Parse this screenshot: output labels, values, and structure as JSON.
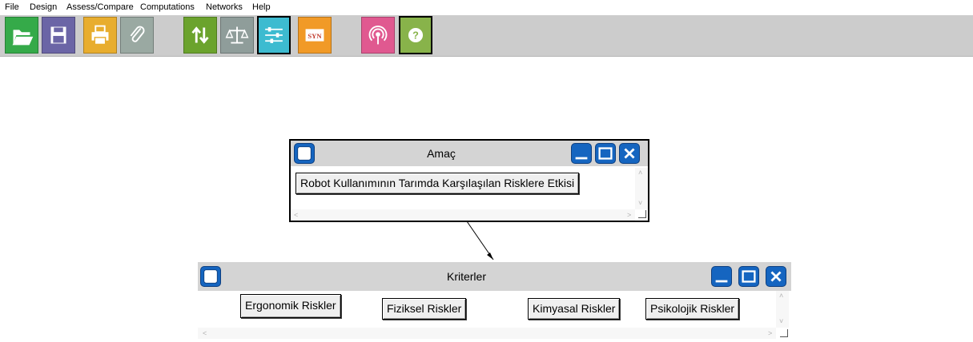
{
  "menu": {
    "items": [
      "File",
      "Design",
      "Assess/Compare",
      "Computations",
      "Networks",
      "Help"
    ]
  },
  "toolbar": {
    "buttons": [
      {
        "icon": "folder-open-icon",
        "color": "#35aa49"
      },
      {
        "icon": "save-icon",
        "color": "#6b65a6"
      },
      {
        "icon": "print-icon",
        "color": "#e8ad2e"
      },
      {
        "icon": "paperclip-icon",
        "color": "#9aa9a2"
      },
      {
        "icon": "sort-arrows-icon",
        "color": "#6ba32d"
      },
      {
        "icon": "balance-scale-icon",
        "color": "#8f9d9a"
      },
      {
        "icon": "sliders-icon",
        "color": "#3dbbd0"
      },
      {
        "icon": "syn-icon",
        "label": "SYN",
        "color": "#f19a27"
      },
      {
        "icon": "broadcast-icon",
        "color": "#e05990"
      },
      {
        "icon": "help-icon",
        "color": "#88b34a"
      }
    ]
  },
  "nodes": {
    "goal": {
      "title": "Amaç",
      "items": [
        "Robot Kullanımının  Tarımda Karşılaşılan  Risklere Etkisi"
      ]
    },
    "criteria": {
      "title": "Kriterler",
      "items": [
        "Ergonomik Riskler",
        "Fiziksel Riskler",
        "Kimyasal Riskler",
        "Psikolojik Riskler"
      ]
    }
  },
  "scroll_glyphs": {
    "up": "˄",
    "down": "˅",
    "left": "<",
    "right": ">"
  },
  "colors": {
    "toolbar_bg": "#cccccc",
    "title_bg": "#d4d4d4",
    "window_button": "#1565c0"
  }
}
